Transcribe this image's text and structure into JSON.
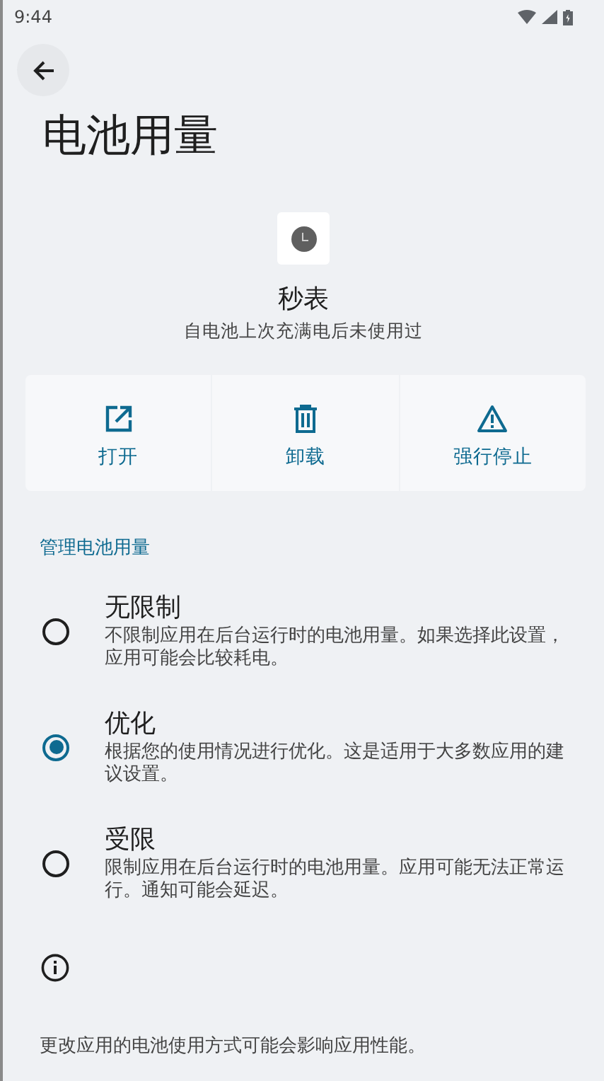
{
  "status_bar": {
    "time": "9:44"
  },
  "title": "电池用量",
  "app": {
    "name": "秒表",
    "subtitle": "自电池上次充满电后未使用过"
  },
  "actions": [
    {
      "kind": "open",
      "label": "打开"
    },
    {
      "kind": "uninstall",
      "label": "卸载"
    },
    {
      "kind": "force_stop",
      "label": "强行停止"
    }
  ],
  "section_header": "管理电池用量",
  "options": [
    {
      "title": "无限制",
      "description": "不限制应用在后台运行时的电池用量。如果选择此设置，应用可能会比较耗电。",
      "selected": false
    },
    {
      "title": "优化",
      "description": "根据您的使用情况进行优化。这是适用于大多数应用的建议设置。",
      "selected": true
    },
    {
      "title": "受限",
      "description": "限制应用在后台运行时的电池用量。应用可能无法正常运行。通知可能会延迟。",
      "selected": false
    }
  ],
  "footer": {
    "text": "更改应用的电池使用方式可能会影响应用性能。"
  }
}
